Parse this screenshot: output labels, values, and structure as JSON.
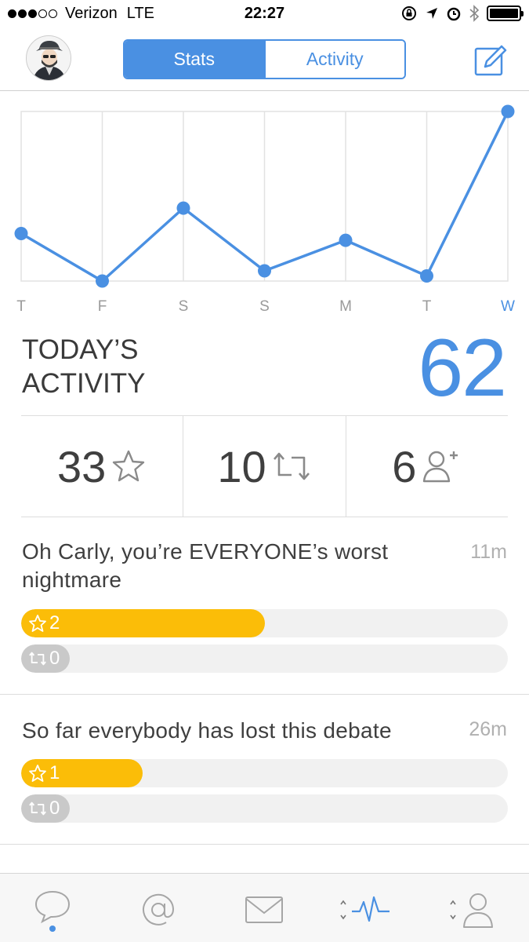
{
  "status_bar": {
    "carrier": "Verizon",
    "network": "LTE",
    "time": "22:27",
    "signal_bars_filled": 3,
    "signal_bars_total": 5
  },
  "header": {
    "tabs": [
      {
        "label": "Stats",
        "active": true
      },
      {
        "label": "Activity",
        "active": false
      }
    ],
    "icons": [
      "avatar",
      "compose-icon"
    ]
  },
  "chart_data": {
    "type": "line",
    "categories": [
      "T",
      "F",
      "S",
      "S",
      "M",
      "T",
      "W"
    ],
    "values": [
      28,
      0,
      43,
      6,
      24,
      3,
      100
    ],
    "ylim": [
      0,
      100
    ],
    "grid": true,
    "highlight_last": true,
    "colors": {
      "line": "#4a90e2",
      "grid": "#e2e2e2",
      "tick": "#9a9a9a",
      "tick_active": "#4a90e2"
    }
  },
  "today": {
    "label_line1": "TODAY’S",
    "label_line2": "ACTIVITY",
    "value": "62"
  },
  "stats": [
    {
      "value": "33",
      "icon": "star-icon"
    },
    {
      "value": "10",
      "icon": "retweet-icon"
    },
    {
      "value": "6",
      "icon": "follower-add-icon"
    }
  ],
  "tweets": [
    {
      "text_line1": "Oh Carly, you’re EVERYONE’s worst",
      "text_line2": "nightmare",
      "age": "11m",
      "favorites": "2",
      "favorites_fraction": 0.5,
      "retweets": "0"
    },
    {
      "text_line1": "So far everybody has lost this debate",
      "age": "26m",
      "favorites": "1",
      "favorites_fraction": 0.25,
      "retweets": "0"
    }
  ],
  "tab_bar": {
    "items": [
      "timeline-icon",
      "mentions-icon",
      "messages-icon",
      "activity-icon",
      "profile-icon"
    ],
    "active": "activity-icon"
  },
  "colors": {
    "accent": "#4a90e2",
    "favorite": "#fbbd08",
    "retweet": "#c9c9c9"
  }
}
